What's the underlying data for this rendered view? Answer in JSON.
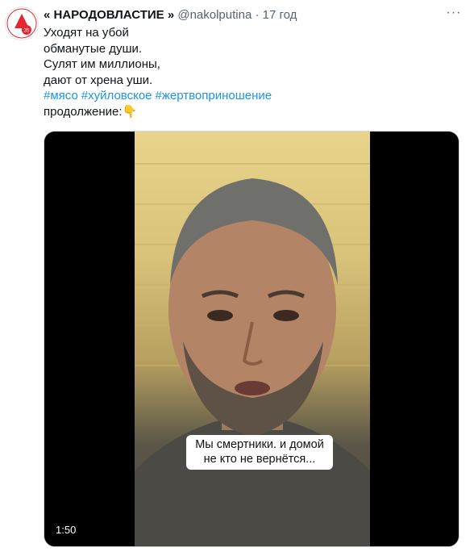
{
  "tweet": {
    "author_name": "« НАРОДОВЛАСТИЕ »",
    "handle": "@nakolputina",
    "separator": "·",
    "time": "17 год",
    "more_icon": "more-dots-icon",
    "lines": [
      "Уходят на убой",
      "обманутые души.",
      "Сулят им миллионы,",
      "дают от хрена уши."
    ],
    "hashtags": [
      "#мясо",
      "#хуйловское",
      "#жертвоприношение"
    ],
    "continuation": "продолжение:👇"
  },
  "video": {
    "caption_line1": "Мы смертники. и домой",
    "caption_line2": "не кто не вернётся...",
    "duration": "1:50"
  },
  "colors": {
    "link": "#1b95e0",
    "secondary_text": "#536471",
    "avatar_accent": "#e3262f"
  }
}
